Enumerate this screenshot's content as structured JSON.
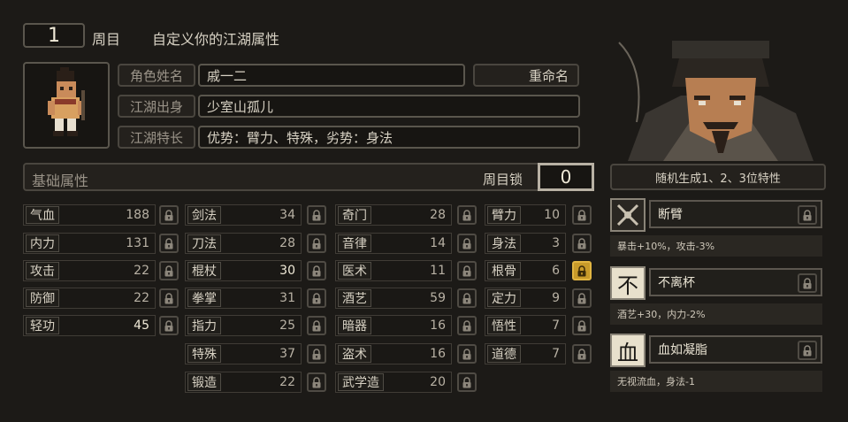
{
  "header": {
    "cycle_number": "1",
    "cycle_label": "周目",
    "subtitle": "自定义你的江湖属性"
  },
  "profile": {
    "name_label": "角色姓名",
    "name_value": "戚一二",
    "rename_button": "重命名",
    "origin_label": "江湖出身",
    "origin_value": "少室山孤儿",
    "trait_label": "江湖特长",
    "trait_value": "优势：臂力、特殊，劣势：身法"
  },
  "base_attr": {
    "title": "基础属性",
    "lock_label": "周目锁",
    "lock_value": "0"
  },
  "stats_col1": [
    {
      "name": "气血",
      "value": "188",
      "highlight": false
    },
    {
      "name": "内力",
      "value": "131",
      "highlight": false
    },
    {
      "name": "攻击",
      "value": "22",
      "highlight": false
    },
    {
      "name": "防御",
      "value": "22",
      "highlight": false
    },
    {
      "name": "轻功",
      "value": "45",
      "highlight": true
    }
  ],
  "stats_col2": [
    {
      "name": "剑法",
      "value": "34",
      "highlight": false
    },
    {
      "name": "刀法",
      "value": "28",
      "highlight": false
    },
    {
      "name": "棍杖",
      "value": "30",
      "highlight": true
    },
    {
      "name": "拳掌",
      "value": "31",
      "highlight": false
    },
    {
      "name": "指力",
      "value": "25",
      "highlight": false
    },
    {
      "name": "特殊",
      "value": "37",
      "highlight": false
    },
    {
      "name": "锻造",
      "value": "22",
      "highlight": false
    }
  ],
  "stats_col3": [
    {
      "name": "奇门",
      "value": "28",
      "highlight": false
    },
    {
      "name": "音律",
      "value": "14",
      "highlight": false
    },
    {
      "name": "医术",
      "value": "11",
      "highlight": false
    },
    {
      "name": "酒艺",
      "value": "59",
      "highlight": false
    },
    {
      "name": "暗器",
      "value": "16",
      "highlight": false
    },
    {
      "name": "盗术",
      "value": "16",
      "highlight": false
    },
    {
      "name": "武学造",
      "value": "20",
      "highlight": false
    }
  ],
  "stats_col4": [
    {
      "name": "臂力",
      "value": "10",
      "locked": false
    },
    {
      "name": "身法",
      "value": "3",
      "locked": false
    },
    {
      "name": "根骨",
      "value": "6",
      "locked": true
    },
    {
      "name": "定力",
      "value": "9",
      "locked": false
    },
    {
      "name": "悟性",
      "value": "7",
      "locked": false
    },
    {
      "name": "道德",
      "value": "7",
      "locked": false
    }
  ],
  "traits_panel": {
    "random_button": "随机生成1、2、3位特性",
    "traits": [
      {
        "name": "断臂",
        "glyph": "",
        "desc": "暴击+10%，攻击-3%"
      },
      {
        "name": "不离杯",
        "glyph": "不",
        "desc": "酒艺+30，内力-2%"
      },
      {
        "name": "血如凝脂",
        "glyph": "血",
        "desc": "无视流血，身法-1"
      }
    ]
  },
  "colors": {
    "accent_gold": "#c89a2a",
    "panel_bg": "#24211d",
    "background": "#1c1a17"
  }
}
